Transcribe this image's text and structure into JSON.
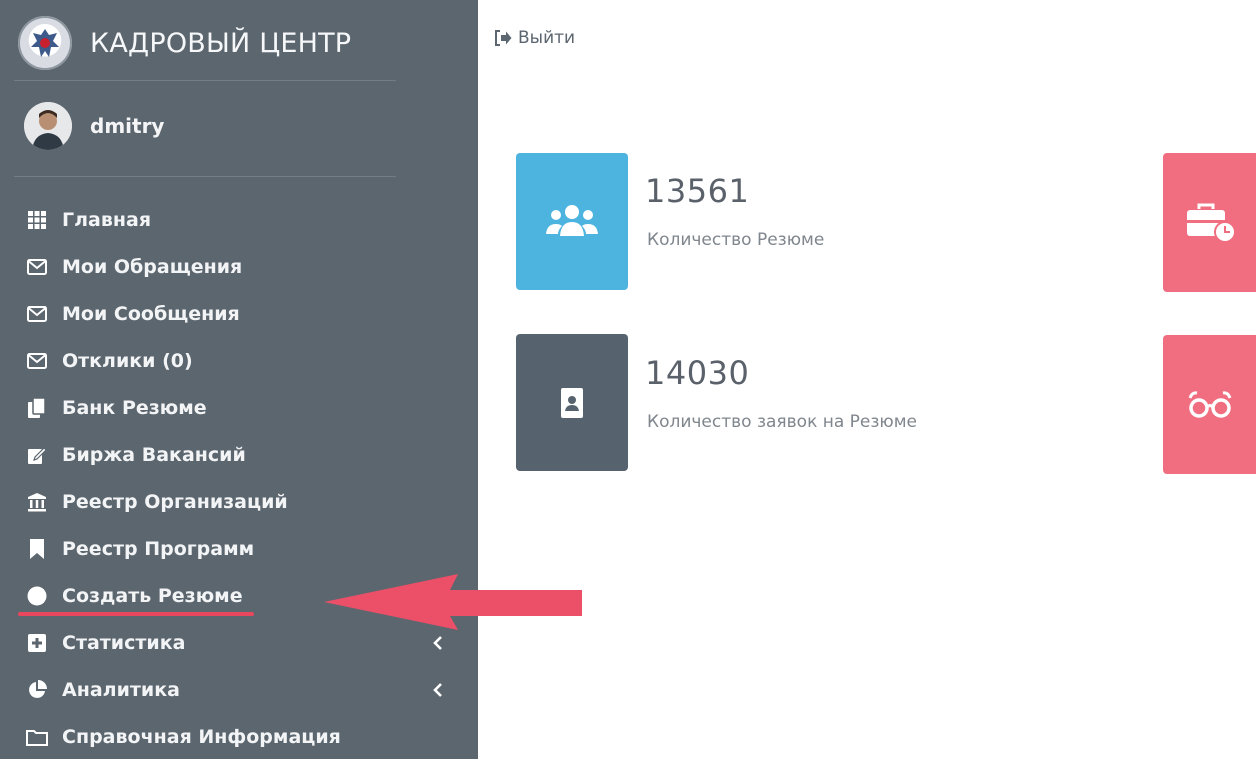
{
  "app": {
    "title": "КАДРОВЫЙ ЦЕНТР"
  },
  "user": {
    "name": "dmitry"
  },
  "header": {
    "logout_label": "Выйти"
  },
  "sidebar": {
    "items": [
      {
        "label": "Главная",
        "icon": "grid-icon"
      },
      {
        "label": "Мои Обращения",
        "icon": "envelope-icon"
      },
      {
        "label": "Мои Сообщения",
        "icon": "envelope-icon"
      },
      {
        "label": "Отклики (0)",
        "icon": "envelope-icon"
      },
      {
        "label": "Банк Резюме",
        "icon": "copy-icon"
      },
      {
        "label": "Биржа Вакансий",
        "icon": "edit-icon"
      },
      {
        "label": "Реестр Организаций",
        "icon": "bank-icon"
      },
      {
        "label": "Реестр Программ",
        "icon": "bookmark-icon"
      },
      {
        "label": "Создать Резюме",
        "icon": "circle-icon"
      },
      {
        "label": "Статистика",
        "icon": "plus-square-icon",
        "has_submenu": true
      },
      {
        "label": "Аналитика",
        "icon": "pie-chart-icon",
        "has_submenu": true
      },
      {
        "label": "Справочная Информация",
        "icon": "folder-icon"
      }
    ]
  },
  "stats": [
    {
      "value": "13561",
      "label": "Количество Резюме",
      "icon": "users-icon",
      "color": "#4db4e0"
    },
    {
      "value": "14030",
      "label": "Количество заявок на Резюме",
      "icon": "id-card-icon",
      "color": "#56636e"
    }
  ],
  "stats_right": [
    {
      "icon": "briefcase-clock-icon",
      "color": "#f06e7f"
    },
    {
      "icon": "glasses-icon",
      "color": "#f06e7f"
    }
  ],
  "colors": {
    "sidebar_bg": "#5c666f",
    "annotation": "#e8475d"
  }
}
